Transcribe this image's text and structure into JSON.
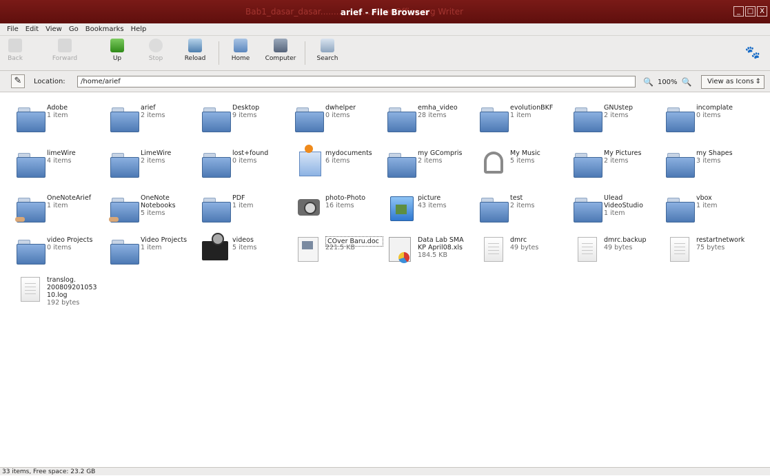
{
  "window": {
    "background_title": "Bab1_dasar_dasar....................OpenOffice.org Writer",
    "title": "arief - File Browser",
    "buttons": [
      "_",
      "□",
      "X"
    ]
  },
  "menu": [
    "File",
    "Edit",
    "View",
    "Go",
    "Bookmarks",
    "Help"
  ],
  "toolbar": {
    "back": "Back",
    "forward": "Forward",
    "up": "Up",
    "stop": "Stop",
    "reload": "Reload",
    "home": "Home",
    "computer": "Computer",
    "search": "Search"
  },
  "location": {
    "label": "Location:",
    "value": "/home/arief",
    "zoom": "100%",
    "view_mode": "View as Icons"
  },
  "items": [
    {
      "name": "Adobe",
      "sub": "1 item",
      "icon": "folder"
    },
    {
      "name": "arief",
      "sub": "2 items",
      "icon": "folder"
    },
    {
      "name": "Desktop",
      "sub": "9 items",
      "icon": "folder"
    },
    {
      "name": "dwhelper",
      "sub": "0 items",
      "icon": "folder"
    },
    {
      "name": "emha_video",
      "sub": "28 items",
      "icon": "folder"
    },
    {
      "name": "evolutionBKF",
      "sub": "1 item",
      "icon": "folder"
    },
    {
      "name": "GNUstep",
      "sub": "2 items",
      "icon": "folder"
    },
    {
      "name": "incomplate",
      "sub": "0 items",
      "icon": "folder"
    },
    {
      "name": "limeWire",
      "sub": "4 items",
      "icon": "folder"
    },
    {
      "name": "LimeWire",
      "sub": "2 items",
      "icon": "folder"
    },
    {
      "name": "lost+found",
      "sub": "0 items",
      "icon": "folder"
    },
    {
      "name": "mydocuments",
      "sub": "6 items",
      "icon": "documents-folder"
    },
    {
      "name": "my GCompris",
      "sub": "2 items",
      "icon": "folder"
    },
    {
      "name": "My Music",
      "sub": "5 items",
      "icon": "music-headphones"
    },
    {
      "name": "My Pictures",
      "sub": "2 items",
      "icon": "folder"
    },
    {
      "name": "my Shapes",
      "sub": "3 items",
      "icon": "folder"
    },
    {
      "name": "OneNoteArief",
      "sub": "1 item",
      "icon": "shared-folder"
    },
    {
      "name": "OneNote\nNotebooks",
      "sub": "5 items",
      "icon": "shared-folder"
    },
    {
      "name": "PDF",
      "sub": "1 item",
      "icon": "folder"
    },
    {
      "name": "photo-Photo",
      "sub": "16 items",
      "icon": "camera"
    },
    {
      "name": "picture",
      "sub": "43 items",
      "icon": "pictures-folder"
    },
    {
      "name": "test",
      "sub": "2 items",
      "icon": "folder"
    },
    {
      "name": "Ulead\nVideoStudio",
      "sub": "1 item",
      "icon": "folder"
    },
    {
      "name": "vbox",
      "sub": "1 item",
      "icon": "folder"
    },
    {
      "name": "video Projects",
      "sub": "0 items",
      "icon": "folder"
    },
    {
      "name": "Video Projects",
      "sub": "1 item",
      "icon": "folder"
    },
    {
      "name": "videos",
      "sub": "5 items",
      "icon": "video-clapper"
    },
    {
      "name": "COver Baru.doc",
      "sub": "221.5 KB",
      "icon": "document"
    },
    {
      "name": "Data Lab SMA\nKP April08.xls",
      "sub": "184.5 KB",
      "icon": "spreadsheet"
    },
    {
      "name": "dmrc",
      "sub": "49 bytes",
      "icon": "text-file"
    },
    {
      "name": "dmrc.backup",
      "sub": "49 bytes",
      "icon": "text-file"
    },
    {
      "name": "restartnetwork",
      "sub": "75 bytes",
      "icon": "text-file"
    },
    {
      "name": "translog.\n200809201053\n10.log",
      "sub": "192 bytes",
      "icon": "text-file"
    }
  ],
  "status": "33 items, Free space: 23.2 GB"
}
